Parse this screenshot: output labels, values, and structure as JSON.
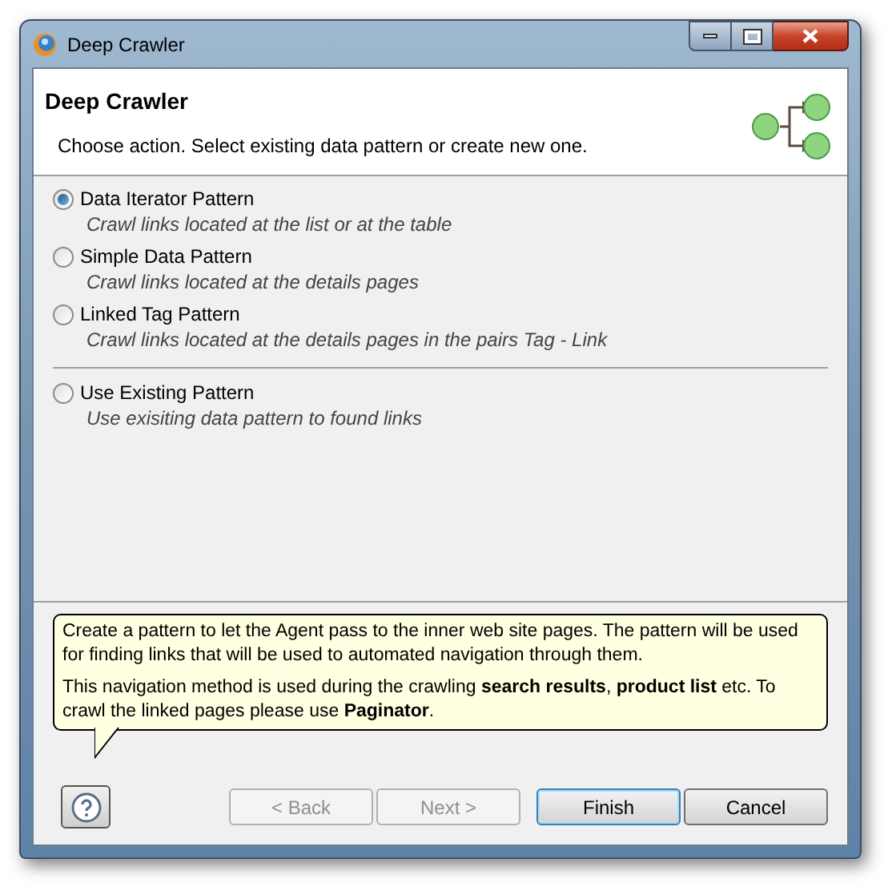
{
  "window": {
    "title": "Deep Crawler"
  },
  "header": {
    "title": "Deep Crawler",
    "subtitle": "Choose action. Select existing data pattern or create new one."
  },
  "option_groups": [
    [
      {
        "label": "Data Iterator Pattern",
        "description": "Crawl links located at the list or at the table",
        "selected": true
      },
      {
        "label": "Simple Data Pattern",
        "description": "Crawl links located at the details pages",
        "selected": false
      },
      {
        "label": "Linked Tag Pattern",
        "description": "Crawl links located at the details pages in the pairs Tag - Link",
        "selected": false
      }
    ],
    [
      {
        "label": "Use Existing Pattern",
        "description": "Use exisiting data pattern to found links",
        "selected": false
      }
    ]
  ],
  "tooltip": [
    "Create a pattern to let the Agent pass to the inner web site pages. The pattern will be used for finding links that will be used to automated navigation through them.",
    "This navigation method is used during the crawling **search results**, **product list** etc. To crawl the linked pages please use **Paginator**."
  ],
  "buttons": [
    {
      "label": "< Back",
      "disabled": true,
      "default": false
    },
    {
      "label": "Next >",
      "disabled": true,
      "default": false
    },
    {
      "label": "Finish",
      "disabled": false,
      "default": true
    },
    {
      "label": "Cancel",
      "disabled": false,
      "default": false
    }
  ]
}
